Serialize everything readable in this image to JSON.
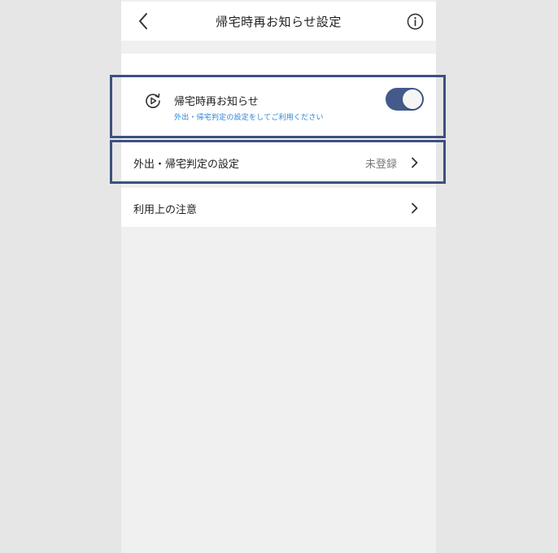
{
  "header": {
    "title": "帰宅時再お知らせ設定",
    "back_icon": "chevron-left-icon",
    "info_icon": "info-circle-icon"
  },
  "settings": {
    "toggle_item": {
      "label": "帰宅時再お知らせ",
      "description": "外出・帰宅判定の設定をしてご利用ください",
      "icon": "replay-icon",
      "enabled": true
    },
    "register_item": {
      "label": "外出・帰宅判定の設定",
      "status": "未登録"
    },
    "notice_item": {
      "label": "利用上の注意"
    }
  },
  "colors": {
    "accent": "#435a8a",
    "highlight_border": "#3c5180",
    "description_text": "#2a86d6",
    "background": "#f0f0f0",
    "outer_background": "#e6e6e6"
  }
}
